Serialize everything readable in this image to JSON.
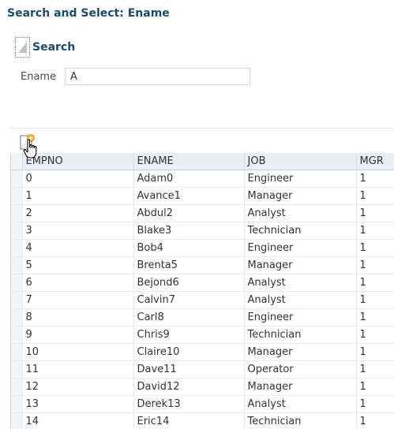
{
  "dialog": {
    "title": "Search and Select: Ename"
  },
  "search": {
    "header_label": "Search",
    "field_label": "Ename",
    "field_value": "A"
  },
  "toolbar": {
    "new_icon": "new-row-icon"
  },
  "table": {
    "columns": [
      "EMPNO",
      "ENAME",
      "JOB",
      "MGR"
    ],
    "rows": [
      [
        "0",
        "Adam0",
        "Engineer",
        "1"
      ],
      [
        "1",
        "Avance1",
        "Manager",
        "1"
      ],
      [
        "2",
        "Abdul2",
        "Analyst",
        "1"
      ],
      [
        "3",
        "Blake3",
        "Technician",
        "1"
      ],
      [
        "4",
        "Bob4",
        "Engineer",
        "1"
      ],
      [
        "5",
        "Brenta5",
        "Manager",
        "1"
      ],
      [
        "6",
        "Bejond6",
        "Analyst",
        "1"
      ],
      [
        "7",
        "Calvin7",
        "Analyst",
        "1"
      ],
      [
        "8",
        "Carl8",
        "Engineer",
        "1"
      ],
      [
        "9",
        "Chris9",
        "Technician",
        "1"
      ],
      [
        "10",
        "Claire10",
        "Manager",
        "1"
      ],
      [
        "11",
        "Dave11",
        "Operator",
        "1"
      ],
      [
        "12",
        "David12",
        "Manager",
        "1"
      ],
      [
        "13",
        "Derek13",
        "Analyst",
        "1"
      ],
      [
        "14",
        "Eric14",
        "Technician",
        "1"
      ]
    ]
  }
}
